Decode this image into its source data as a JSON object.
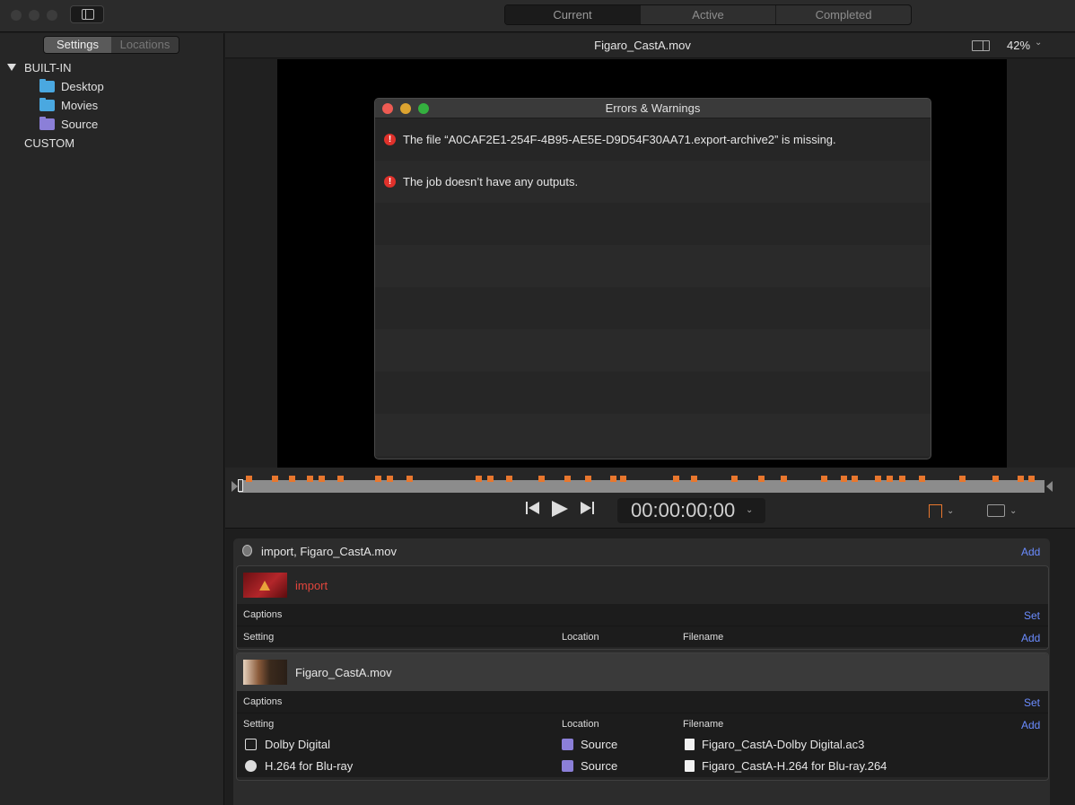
{
  "toolbar": {
    "tabs": [
      "Current",
      "Active",
      "Completed"
    ],
    "active_tab": "Current"
  },
  "sidebar": {
    "tabs": [
      "Settings",
      "Locations"
    ],
    "active_tab": "Settings",
    "builtin_label": "BUILT-IN",
    "items": [
      {
        "label": "Desktop",
        "color": "#4aa8e0"
      },
      {
        "label": "Movies",
        "color": "#4aa8e0"
      },
      {
        "label": "Source",
        "color": "#8b7fd8"
      }
    ],
    "custom_label": "CUSTOM"
  },
  "viewer": {
    "title": "Figaro_CastA.mov",
    "zoom": "42%"
  },
  "dialog": {
    "title": "Errors & Warnings",
    "errors": [
      "The file “A0CAF2E1-254F-4B95-AE5E-D9D54F30AA71.export-archive2” is missing.",
      "The job doesn’t have any outputs."
    ]
  },
  "transport": {
    "timecode": "00:00:00;00"
  },
  "batch": {
    "title": "import, Figaro_CastA.mov",
    "add_label": "Add",
    "jobs": [
      {
        "name": "import",
        "name_color": "#e0453c",
        "captions_label": "Captions",
        "set_label": "Set",
        "col_setting": "Setting",
        "col_location": "Location",
        "col_filename": "Filename",
        "add_label": "Add",
        "outputs": []
      },
      {
        "name": "Figaro_CastA.mov",
        "name_color": "#e6e6e6",
        "captions_label": "Captions",
        "set_label": "Set",
        "col_setting": "Setting",
        "col_location": "Location",
        "col_filename": "Filename",
        "add_label": "Add",
        "outputs": [
          {
            "setting": "Dolby Digital",
            "location": "Source",
            "filename": "Figaro_CastA-Dolby Digital.ac3"
          },
          {
            "setting": "H.264 for Blu-ray",
            "location": "Source",
            "filename": "Figaro_CastA-H.264 for Blu-ray.264"
          }
        ]
      }
    ]
  },
  "accent_colors": {
    "marker": "#e8772e",
    "link": "#6b8cff",
    "error": "#e0312b"
  }
}
